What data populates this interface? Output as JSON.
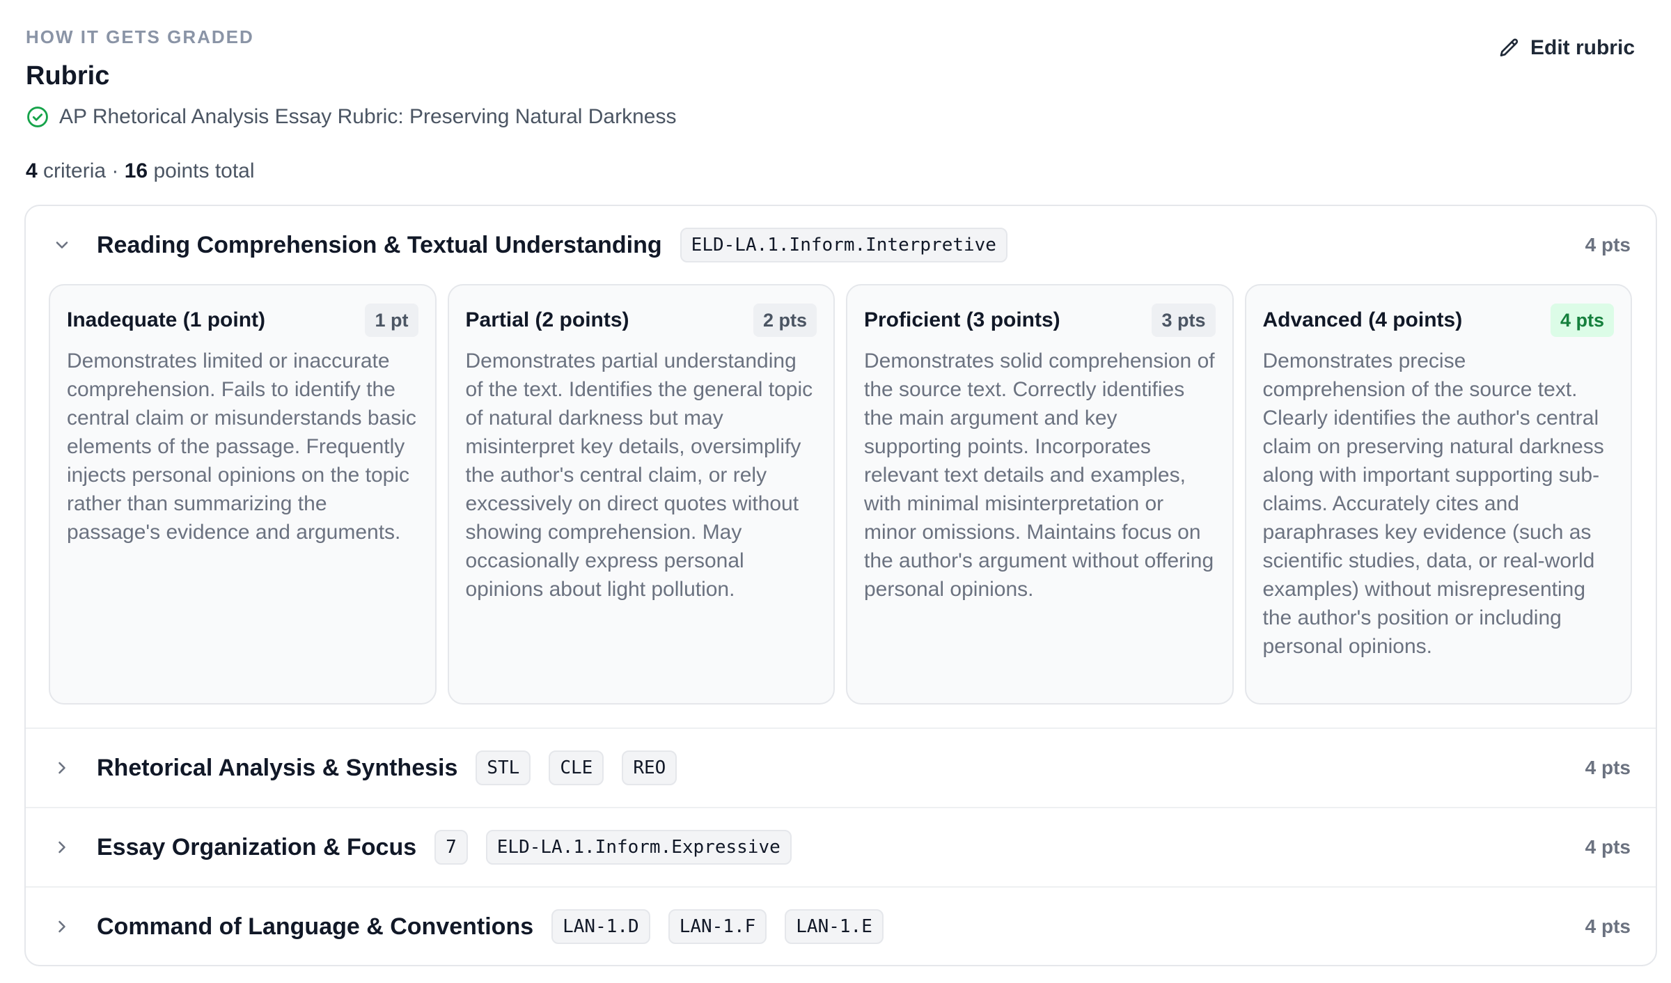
{
  "header": {
    "eyebrow": "HOW IT GETS GRADED",
    "title": "Rubric",
    "rubric_name": "AP Rhetorical Analysis Essay Rubric: Preserving Natural Darkness",
    "criteria_count": "4",
    "criteria_label": "criteria ·",
    "points_total": "16",
    "points_label": "points total",
    "edit_label": "Edit rubric"
  },
  "criteria": [
    {
      "name": "Reading Comprehension & Textual Understanding",
      "tags": [
        "ELD-LA.1.Inform.Interpretive"
      ],
      "points": "4 pts",
      "expanded": true,
      "levels": [
        {
          "title": "Inadequate (1 point)",
          "badge": "1 pt",
          "description": "Demonstrates limited or inaccurate comprehension. Fails to identify the central claim or misunderstands basic elements of the passage. Frequently injects personal opinions on the topic rather than summarizing the passage's evidence and arguments."
        },
        {
          "title": "Partial (2 points)",
          "badge": "2 pts",
          "description": "Demonstrates partial understanding of the text. Identifies the general topic of natural darkness but may misinterpret key details, oversimplify the author's central claim, or rely excessively on direct quotes without showing comprehension. May occasionally express personal opinions about light pollution."
        },
        {
          "title": "Proficient (3 points)",
          "badge": "3 pts",
          "description": "Demonstrates solid comprehension of the source text. Correctly identifies the main argument and key supporting points. Incorporates relevant text details and examples, with minimal misinterpretation or minor omissions. Maintains focus on the author's argument without offering personal opinions."
        },
        {
          "title": "Advanced (4 points)",
          "badge": "4 pts",
          "description": "Demonstrates precise comprehension of the source text. Clearly identifies the author's central claim on preserving natural darkness along with important supporting sub-claims. Accurately cites and paraphrases key evidence (such as scientific studies, data, or real-world examples) without misrepresenting the author's position or including personal opinions."
        }
      ]
    },
    {
      "name": "Rhetorical Analysis & Synthesis",
      "tags": [
        "STL",
        "CLE",
        "REO"
      ],
      "points": "4 pts",
      "expanded": false
    },
    {
      "name": "Essay Organization & Focus",
      "tags": [
        "7",
        "ELD-LA.1.Inform.Expressive"
      ],
      "points": "4 pts",
      "expanded": false
    },
    {
      "name": "Command of Language & Conventions",
      "tags": [
        "LAN-1.D",
        "LAN-1.F",
        "LAN-1.E"
      ],
      "points": "4 pts",
      "expanded": false
    }
  ],
  "colors": {
    "accent_green": "#15803d",
    "badge_green_bg": "#dcfce7",
    "check_green": "#16a34a"
  },
  "icons": {
    "edit": "pencil-icon",
    "status": "check-circle-icon",
    "expanded": "chevron-down-icon",
    "collapsed": "chevron-right-icon"
  }
}
